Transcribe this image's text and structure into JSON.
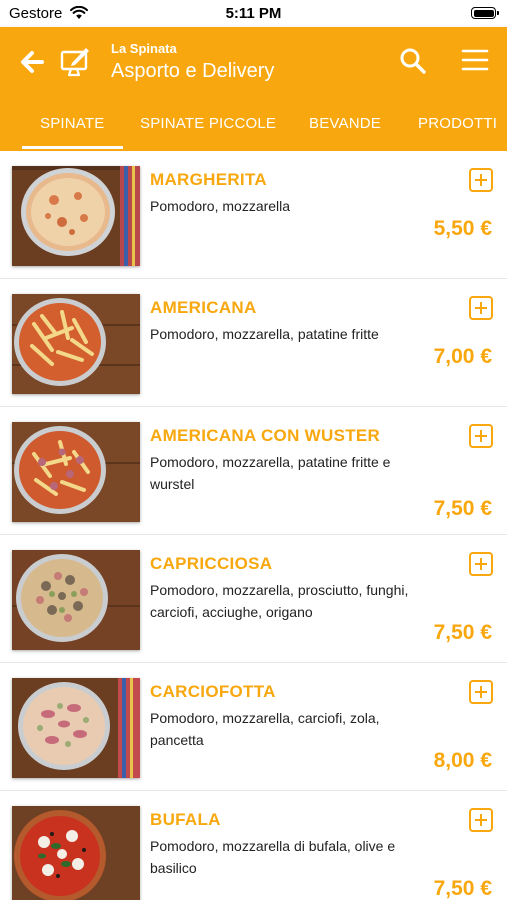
{
  "status_bar": {
    "carrier": "Gestore",
    "time": "5:11 PM"
  },
  "header": {
    "restaurant": "La Spinata",
    "title": "Asporto e Delivery"
  },
  "tabs": [
    {
      "label": "SPINATE",
      "active": true
    },
    {
      "label": "SPINATE PICCOLE"
    },
    {
      "label": "BEVANDE"
    },
    {
      "label": "PRODOTTI"
    }
  ],
  "menu_items": [
    {
      "name": "MARGHERITA",
      "description": "Pomodoro, mozzarella",
      "price": "5,50 €"
    },
    {
      "name": "AMERICANA",
      "description": "Pomodoro, mozzarella, patatine fritte",
      "price": "7,00 €"
    },
    {
      "name": "AMERICANA CON WUSTER",
      "description": "Pomodoro, mozzarella, patatine fritte e wurstel",
      "price": "7,50 €"
    },
    {
      "name": "CAPRICCIOSA",
      "description": "Pomodoro, mozzarella, prosciutto, funghi, carciofi, acciughe, origano",
      "price": "7,50 €"
    },
    {
      "name": "CARCIOFOTTA",
      "description": "Pomodoro, mozzarella, carciofi, zola, pancetta",
      "price": "8,00 €"
    },
    {
      "name": "BUFALA",
      "description": "Pomodoro, mozzarella di bufala, olive e basilico",
      "price": "7,50 €"
    }
  ],
  "colors": {
    "accent": "#f8a80e",
    "text": "#222222",
    "divider": "#e6e6e6"
  },
  "icons": [
    "back-arrow-icon",
    "monitor-edit-icon",
    "search-icon",
    "hamburger-menu-icon",
    "add-square-icon",
    "wifi-icon",
    "battery-icon"
  ]
}
